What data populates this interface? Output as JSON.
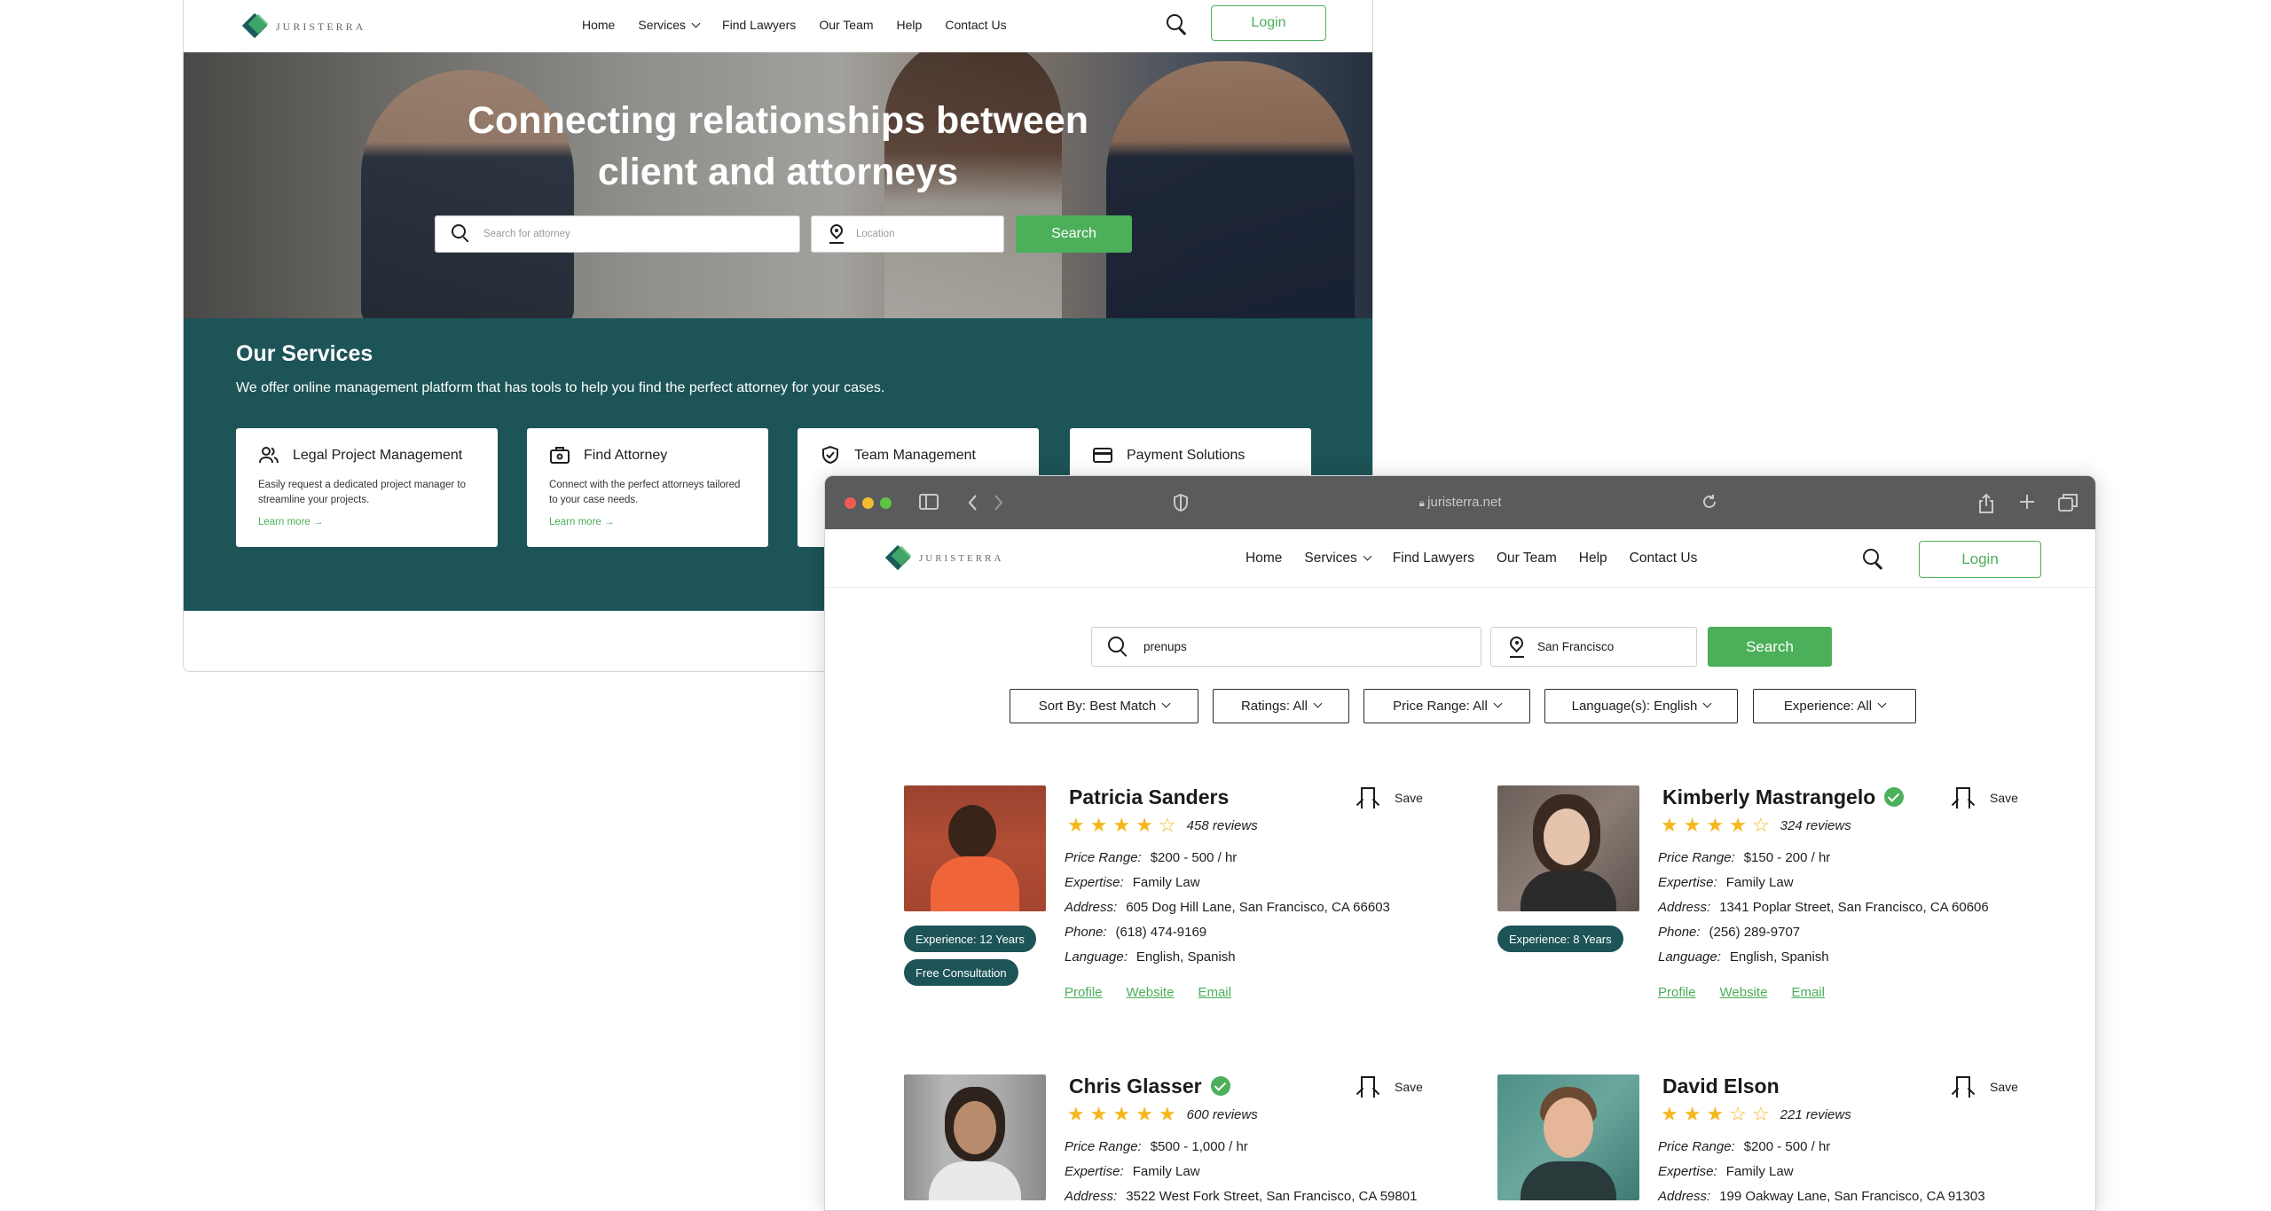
{
  "back": {
    "logo_text": "JURISTERRA",
    "nav": [
      "Home",
      "Services",
      "Find Lawyers",
      "Our Team",
      "Help",
      "Contact Us"
    ],
    "login": "Login",
    "hero_title_line1": "Connecting relationships between",
    "hero_title_line2": "client and attorneys",
    "search_placeholder": "Search for attorney",
    "location_placeholder": "Location",
    "search_button": "Search",
    "services_title": "Our Services",
    "services_desc": "We offer online management platform that has tools to help you find the perfect attorney for your cases.",
    "cards": [
      {
        "title": "Legal Project Management",
        "desc": "Easily request a dedicated project manager to streamline your projects.",
        "link": "Learn more →"
      },
      {
        "title": "Find Attorney",
        "desc": "Connect with the perfect attorneys tailored to your case needs.",
        "link": "Learn more →"
      },
      {
        "title": "Team Management"
      },
      {
        "title": "Payment Solutions"
      }
    ]
  },
  "browser": {
    "url": "juristerra.net"
  },
  "front": {
    "logo_text": "JURISTERRA",
    "nav": [
      "Home",
      "Services",
      "Find Lawyers",
      "Our Team",
      "Help",
      "Contact Us"
    ],
    "login": "Login",
    "search_value": "prenups",
    "location_value": "San Francisco",
    "search_button": "Search",
    "filters": [
      "Sort By: Best Match",
      "Ratings: All",
      "Price Range: All",
      "Language(s): English",
      "Experience: All"
    ],
    "save_label": "Save",
    "labels": {
      "price": "Price Range:",
      "expertise": "Expertise:",
      "address": "Address:",
      "phone": "Phone:",
      "language": "Language:"
    },
    "link_labels": [
      "Profile",
      "Website",
      "Email"
    ],
    "lawyers": [
      {
        "name": "Patricia Sanders",
        "verified": false,
        "rating": 4,
        "reviews": "458 reviews",
        "price": "$200 - 500 / hr",
        "expertise": "Family Law",
        "address": "605 Dog Hill Lane, San Francisco, CA 66603",
        "phone": "(618) 474-9169",
        "language": "English, Spanish",
        "badges": [
          "Experience: 12 Years",
          "Free Consultation"
        ]
      },
      {
        "name": "Kimberly Mastrangelo",
        "verified": true,
        "rating": 4,
        "reviews": "324 reviews",
        "price": "$150 - 200 / hr",
        "expertise": "Family Law",
        "address": "1341 Poplar Street, San Francisco, CA 60606",
        "phone": "(256) 289-9707",
        "language": "English, Spanish",
        "badges": [
          "Experience: 8 Years"
        ]
      },
      {
        "name": "Chris Glasser",
        "verified": true,
        "rating": 5,
        "reviews": "600 reviews",
        "price": "$500 - 1,000 / hr",
        "expertise": "Family Law",
        "address": "3522 West Fork Street, San Francisco, CA 59801"
      },
      {
        "name": "David Elson",
        "verified": false,
        "rating": 3,
        "reviews": "221 reviews",
        "price": "$200 - 500 / hr",
        "expertise": "Family Law",
        "address": "199 Oakway Lane, San Francisco, CA 91303"
      }
    ]
  },
  "colors": {
    "accent": "#4caf5a",
    "teal": "#1d5457",
    "star": "#f5b71b"
  }
}
